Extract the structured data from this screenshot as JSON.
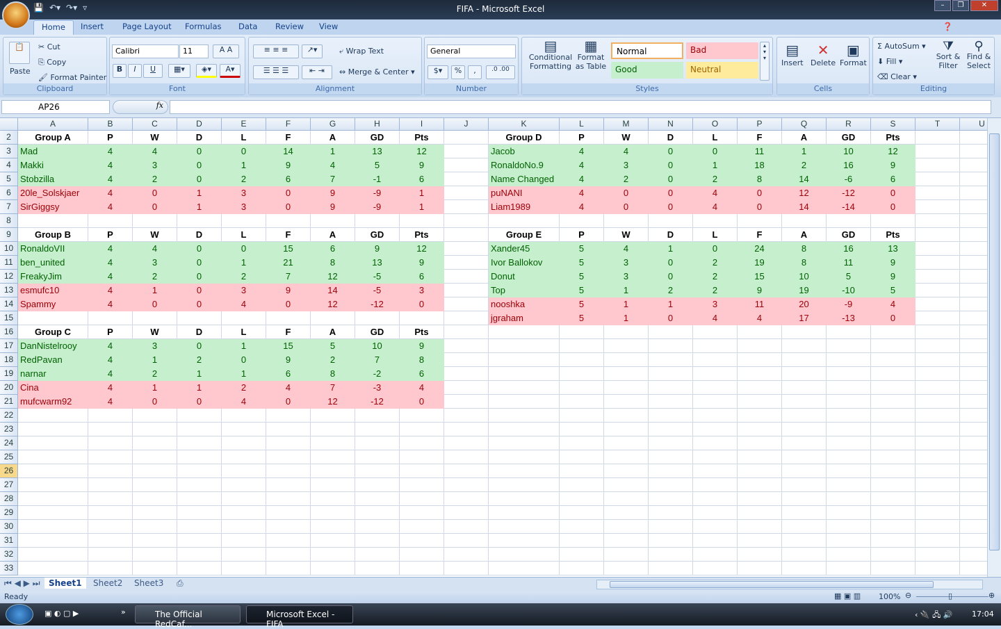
{
  "window": {
    "title": "FIFA - Microsoft Excel"
  },
  "ribbon_tabs": [
    "Home",
    "Insert",
    "Page Layout",
    "Formulas",
    "Data",
    "Review",
    "View"
  ],
  "clipboard": {
    "paste": "Paste",
    "cut": "Cut",
    "copy": "Copy",
    "format_painter": "Format Painter",
    "label": "Clipboard"
  },
  "font": {
    "name": "Calibri",
    "size": "11",
    "bold": "B",
    "italic": "I",
    "underline": "U",
    "label": "Font"
  },
  "alignment": {
    "wrap_text": "Wrap Text",
    "merge_center": "Merge & Center",
    "label": "Alignment"
  },
  "number": {
    "format": "General",
    "percent": "%",
    "comma": ",",
    "label": "Number"
  },
  "styles": {
    "conditional": "Conditional Formatting",
    "format_table": "Format as Table",
    "normal": "Normal",
    "bad": "Bad",
    "good": "Good",
    "neutral": "Neutral",
    "label": "Styles"
  },
  "cells": {
    "insert": "Insert",
    "delete": "Delete",
    "format": "Format",
    "label": "Cells"
  },
  "editing": {
    "autosum": "AutoSum",
    "fill": "Fill",
    "clear": "Clear",
    "sort_filter": "Sort & Filter",
    "find_select": "Find & Select",
    "label": "Editing"
  },
  "formula_bar": {
    "name_box": "AP26",
    "fx": "fx",
    "formula": ""
  },
  "columns": [
    "A",
    "B",
    "C",
    "D",
    "E",
    "F",
    "G",
    "H",
    "I",
    "J",
    "K",
    "L",
    "M",
    "N",
    "O",
    "P",
    "Q",
    "R",
    "S",
    "T",
    "U"
  ],
  "rows": [
    2,
    3,
    4,
    5,
    6,
    7,
    8,
    9,
    10,
    11,
    12,
    13,
    14,
    15,
    16,
    17,
    18,
    19,
    20,
    21,
    22,
    23,
    24,
    25,
    26,
    27,
    28,
    29,
    30,
    31,
    32,
    33
  ],
  "selected_row": 26,
  "table_headers": [
    "P",
    "W",
    "D",
    "L",
    "F",
    "A",
    "GD",
    "Pts"
  ],
  "colors": {
    "good_fill": "#c6efce",
    "good_text": "#006100",
    "bad_fill": "#ffc7ce",
    "bad_text": "#9c0006"
  },
  "groups": [
    {
      "name": "Group A",
      "teams": [
        {
          "name": "Mad",
          "stats": [
            4,
            4,
            0,
            0,
            14,
            1,
            13,
            12
          ],
          "status": "good"
        },
        {
          "name": "Makki",
          "stats": [
            4,
            3,
            0,
            1,
            9,
            4,
            5,
            9
          ],
          "status": "good"
        },
        {
          "name": "Stobzilla",
          "stats": [
            4,
            2,
            0,
            2,
            6,
            7,
            -1,
            6
          ],
          "status": "good"
        },
        {
          "name": "20le_Solskjaer",
          "stats": [
            4,
            0,
            1,
            3,
            0,
            9,
            -9,
            1
          ],
          "status": "bad"
        },
        {
          "name": "SirGiggsy",
          "stats": [
            4,
            0,
            1,
            3,
            0,
            9,
            -9,
            1
          ],
          "status": "bad"
        }
      ]
    },
    {
      "name": "Group B",
      "teams": [
        {
          "name": "RonaldoVII",
          "stats": [
            4,
            4,
            0,
            0,
            15,
            6,
            9,
            12
          ],
          "status": "good"
        },
        {
          "name": "ben_united",
          "stats": [
            4,
            3,
            0,
            1,
            21,
            8,
            13,
            9
          ],
          "status": "good"
        },
        {
          "name": "FreakyJim",
          "stats": [
            4,
            2,
            0,
            2,
            7,
            12,
            -5,
            6
          ],
          "status": "good"
        },
        {
          "name": "esmufc10",
          "stats": [
            4,
            1,
            0,
            3,
            9,
            14,
            -5,
            3
          ],
          "status": "bad"
        },
        {
          "name": "Spammy",
          "stats": [
            4,
            0,
            0,
            4,
            0,
            12,
            -12,
            0
          ],
          "status": "bad"
        }
      ]
    },
    {
      "name": "Group C",
      "teams": [
        {
          "name": "DanNistelrooy",
          "stats": [
            4,
            3,
            0,
            1,
            15,
            5,
            10,
            9
          ],
          "status": "good"
        },
        {
          "name": "RedPavan",
          "stats": [
            4,
            1,
            2,
            0,
            9,
            2,
            7,
            8
          ],
          "status": "good"
        },
        {
          "name": "narnar",
          "stats": [
            4,
            2,
            1,
            1,
            6,
            8,
            -2,
            6
          ],
          "status": "good"
        },
        {
          "name": "Cina",
          "stats": [
            4,
            1,
            1,
            2,
            4,
            7,
            -3,
            4
          ],
          "status": "bad"
        },
        {
          "name": "mufcwarm92",
          "stats": [
            4,
            0,
            0,
            4,
            0,
            12,
            -12,
            0
          ],
          "status": "bad"
        }
      ]
    },
    {
      "name": "Group D",
      "teams": [
        {
          "name": "Jacob",
          "stats": [
            4,
            4,
            0,
            0,
            11,
            1,
            10,
            12
          ],
          "status": "good"
        },
        {
          "name": "RonaldoNo.9",
          "stats": [
            4,
            3,
            0,
            1,
            18,
            2,
            16,
            9
          ],
          "status": "good"
        },
        {
          "name": "Name Changed",
          "stats": [
            4,
            2,
            0,
            2,
            8,
            14,
            -6,
            6
          ],
          "status": "good"
        },
        {
          "name": "puNANI",
          "stats": [
            4,
            0,
            0,
            4,
            0,
            12,
            -12,
            0
          ],
          "status": "bad"
        },
        {
          "name": "Liam1989",
          "stats": [
            4,
            0,
            0,
            4,
            0,
            14,
            -14,
            0
          ],
          "status": "bad"
        }
      ]
    },
    {
      "name": "Group E",
      "teams": [
        {
          "name": "Xander45",
          "stats": [
            5,
            4,
            1,
            0,
            24,
            8,
            16,
            13
          ],
          "status": "good"
        },
        {
          "name": "Ivor Ballokov",
          "stats": [
            5,
            3,
            0,
            2,
            19,
            8,
            11,
            9
          ],
          "status": "good"
        },
        {
          "name": "Donut",
          "stats": [
            5,
            3,
            0,
            2,
            15,
            10,
            5,
            9
          ],
          "status": "good"
        },
        {
          "name": "Top",
          "stats": [
            5,
            1,
            2,
            2,
            9,
            19,
            -10,
            5
          ],
          "status": "good"
        },
        {
          "name": "nooshka",
          "stats": [
            5,
            1,
            1,
            3,
            11,
            20,
            -9,
            4
          ],
          "status": "bad"
        },
        {
          "name": "jgraham",
          "stats": [
            5,
            1,
            0,
            4,
            4,
            17,
            -13,
            0
          ],
          "status": "bad"
        }
      ]
    }
  ],
  "sheet_tabs": [
    "Sheet1",
    "Sheet2",
    "Sheet3"
  ],
  "active_sheet": "Sheet1",
  "status_bar": {
    "ready": "Ready",
    "zoom": "100%"
  },
  "taskbar": {
    "items": [
      "The Official RedCaf...",
      "Microsoft Excel - FIFA"
    ],
    "clock": "17:04"
  }
}
